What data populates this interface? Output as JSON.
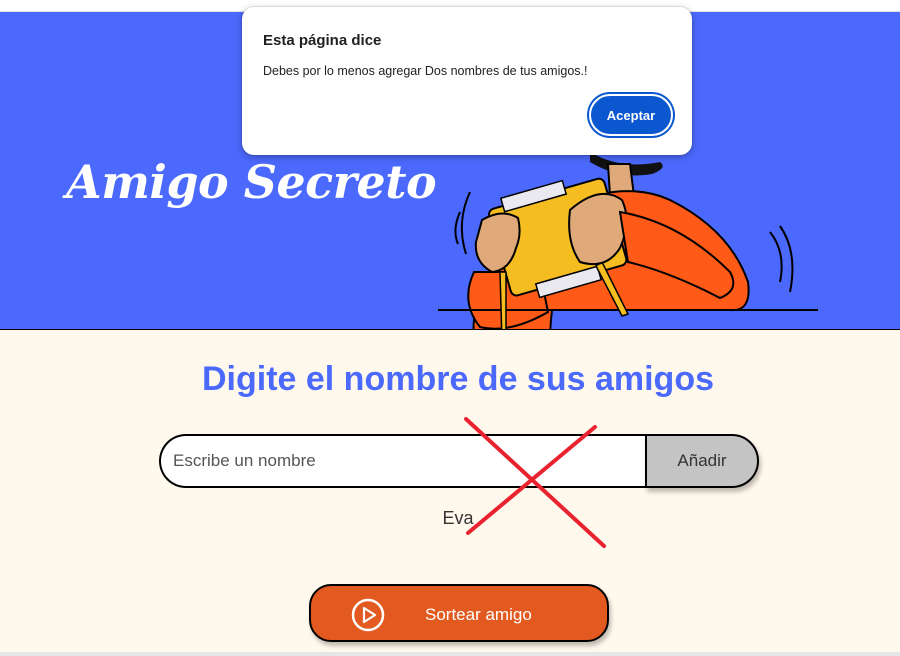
{
  "hero": {
    "title": "Amigo Secreto"
  },
  "main": {
    "heading": "Digite el nombre de sus amigos",
    "input": {
      "placeholder": "Escribe un nombre",
      "value": ""
    },
    "add_button": "Añadir",
    "friends": [
      "Eva"
    ],
    "draw_button": {
      "label": "Sortear amigo",
      "icon": "play-circle-icon"
    }
  },
  "dialog": {
    "title": "Esta página dice",
    "message": "Debes por lo menos agregar Dos nombres de tus amigos.!",
    "accept_button": "Aceptar"
  },
  "colors": {
    "hero_bg": "#4b69fd",
    "heading": "#4b69fd",
    "page_bg": "#fff8ec",
    "draw_button": "#e25a1f",
    "add_button": "#c4c4c4",
    "dialog_accent": "#0b57d0",
    "cross_mark": "#e8232f"
  }
}
